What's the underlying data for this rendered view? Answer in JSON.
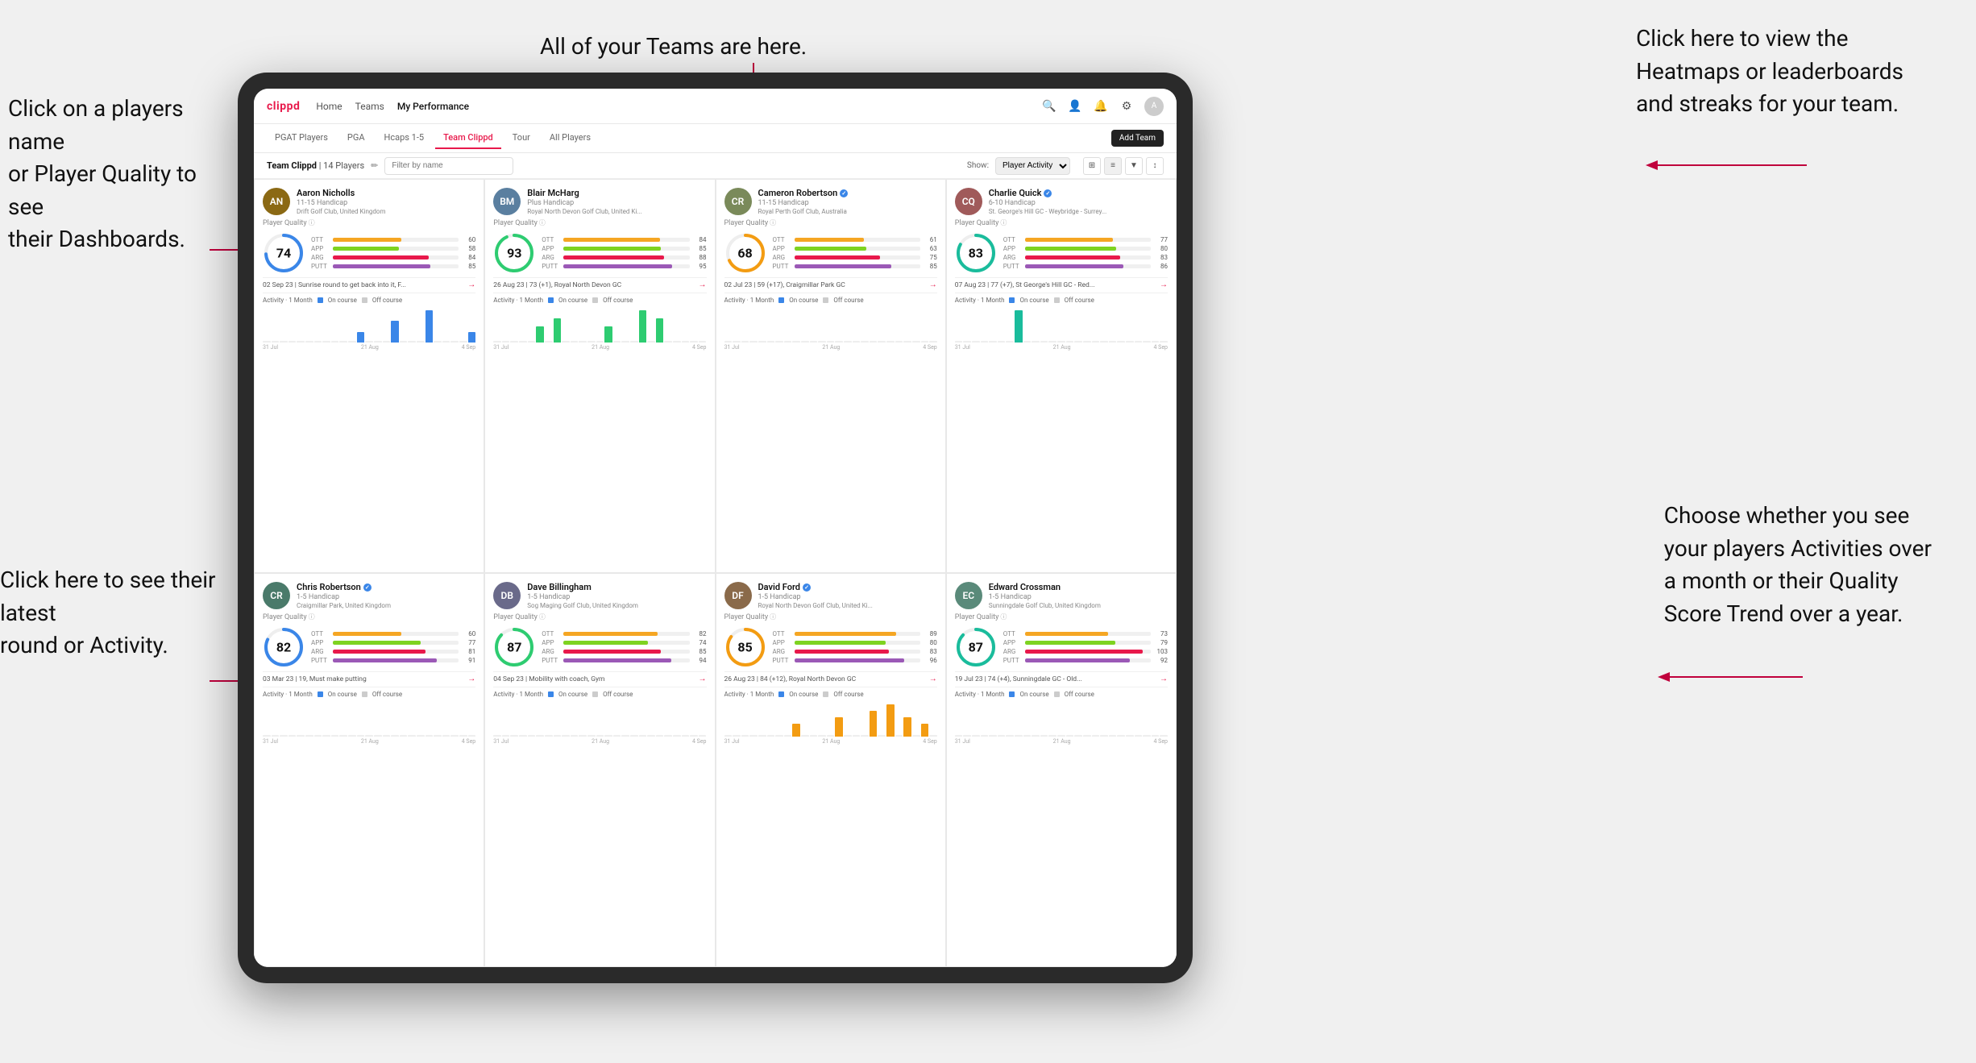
{
  "annotations": {
    "top_center": "All of your Teams are here.",
    "top_right": "Click here to view the\nHeatmaps or leaderboards\nand streaks for your team.",
    "left_top": "Click on a players name\nor Player Quality to see\ntheir Dashboards.",
    "left_bottom": "Click here to see their latest\nround or Activity.",
    "right_bottom": "Choose whether you see\nyour players Activities over\na month or their Quality\nScore Trend over a year."
  },
  "nav": {
    "logo": "clippd",
    "links": [
      "Home",
      "Teams",
      "My Performance"
    ],
    "active": "My Performance"
  },
  "sub_tabs": {
    "tabs": [
      "PGAT Players",
      "PGA",
      "Hcaps 1-5",
      "Team Clippd",
      "Tour",
      "All Players"
    ],
    "active": "Team Clippd",
    "add_button": "Add Team"
  },
  "team_header": {
    "title": "Team Clippd",
    "count": "14 Players",
    "filter_placeholder": "Filter by name",
    "show_label": "Show:",
    "show_options": [
      "Player Activity"
    ],
    "selected": "Player Activity"
  },
  "players": [
    {
      "name": "Aaron Nicholls",
      "handicap": "11-15 Handicap",
      "club": "Drift Golf Club, United Kingdom",
      "verified": false,
      "quality": 74,
      "circle_color": "#3a86e8",
      "stats": {
        "OTT": 60,
        "APP": 58,
        "ARG": 84,
        "PUTT": 85
      },
      "last_round": "02 Sep 23 | Sunrise round to get back into it, F...",
      "activity_bars": [
        0,
        0,
        0,
        0,
        0,
        0,
        0,
        0,
        0,
        0,
        0,
        1,
        0,
        0,
        0,
        2,
        0,
        0,
        0,
        3,
        0,
        0,
        0,
        0,
        1
      ],
      "chart_labels": [
        "31 Jul",
        "21 Aug",
        "4 Sep"
      ]
    },
    {
      "name": "Blair McHarg",
      "handicap": "Plus Handicap",
      "club": "Royal North Devon Golf Club, United Ki...",
      "verified": false,
      "quality": 93,
      "circle_color": "#2ecc71",
      "stats": {
        "OTT": 84,
        "APP": 85,
        "ARG": 88,
        "PUTT": 95
      },
      "last_round": "26 Aug 23 | 73 (+1), Royal North Devon GC",
      "activity_bars": [
        0,
        0,
        0,
        0,
        0,
        2,
        0,
        3,
        0,
        0,
        0,
        0,
        0,
        2,
        0,
        0,
        0,
        4,
        0,
        3,
        0,
        0,
        0,
        0,
        0
      ],
      "chart_labels": [
        "31 Jul",
        "21 Aug",
        "4 Sep"
      ]
    },
    {
      "name": "Cameron Robertson",
      "handicap": "11-15 Handicap",
      "club": "Royal Perth Golf Club, Australia",
      "verified": true,
      "quality": 68,
      "circle_color": "#f39c12",
      "stats": {
        "OTT": 61,
        "APP": 63,
        "ARG": 75,
        "PUTT": 85
      },
      "last_round": "02 Jul 23 | 59 (+17), Craigmillar Park GC",
      "activity_bars": [
        0,
        0,
        0,
        0,
        0,
        0,
        0,
        0,
        0,
        0,
        0,
        0,
        0,
        0,
        0,
        0,
        0,
        0,
        0,
        0,
        0,
        0,
        0,
        0,
        0
      ],
      "chart_labels": [
        "31 Jul",
        "21 Aug",
        "4 Sep"
      ]
    },
    {
      "name": "Charlie Quick",
      "handicap": "6-10 Handicap",
      "club": "St. George's Hill GC - Weybridge - Surrey...",
      "verified": true,
      "quality": 83,
      "circle_color": "#1abc9c",
      "stats": {
        "OTT": 77,
        "APP": 80,
        "ARG": 83,
        "PUTT": 86
      },
      "last_round": "07 Aug 23 | 77 (+7), St George's Hill GC - Red...",
      "activity_bars": [
        0,
        0,
        0,
        0,
        0,
        0,
        0,
        2,
        0,
        0,
        0,
        0,
        0,
        0,
        0,
        0,
        0,
        0,
        0,
        0,
        0,
        0,
        0,
        0,
        0
      ],
      "chart_labels": [
        "31 Jul",
        "21 Aug",
        "4 Sep"
      ]
    },
    {
      "name": "Chris Robertson",
      "handicap": "1-5 Handicap",
      "club": "Craigmillar Park, United Kingdom",
      "verified": true,
      "quality": 82,
      "circle_color": "#3a86e8",
      "stats": {
        "OTT": 60,
        "APP": 77,
        "ARG": 81,
        "PUTT": 91
      },
      "last_round": "03 Mar 23 | 19, Must make putting",
      "activity_bars": [
        0,
        0,
        0,
        0,
        0,
        0,
        0,
        0,
        0,
        0,
        0,
        0,
        0,
        0,
        0,
        0,
        0,
        0,
        0,
        0,
        0,
        0,
        0,
        0,
        0
      ],
      "chart_labels": [
        "31 Jul",
        "21 Aug",
        "4 Sep"
      ]
    },
    {
      "name": "Dave Billingham",
      "handicap": "1-5 Handicap",
      "club": "Sog Maging Golf Club, United Kingdom",
      "verified": false,
      "quality": 87,
      "circle_color": "#2ecc71",
      "stats": {
        "OTT": 82,
        "APP": 74,
        "ARG": 85,
        "PUTT": 94
      },
      "last_round": "04 Sep 23 | Mobility with coach, Gym",
      "activity_bars": [
        0,
        0,
        0,
        0,
        0,
        0,
        0,
        0,
        0,
        0,
        0,
        0,
        0,
        0,
        0,
        0,
        0,
        0,
        0,
        0,
        0,
        0,
        0,
        0,
        0
      ],
      "chart_labels": [
        "31 Jul",
        "21 Aug",
        "4 Sep"
      ]
    },
    {
      "name": "David Ford",
      "handicap": "1-5 Handicap",
      "club": "Royal North Devon Golf Club, United Ki...",
      "verified": true,
      "quality": 85,
      "circle_color": "#f39c12",
      "stats": {
        "OTT": 89,
        "APP": 80,
        "ARG": 83,
        "PUTT": 96
      },
      "last_round": "26 Aug 23 | 84 (+12), Royal North Devon GC",
      "activity_bars": [
        0,
        0,
        0,
        0,
        0,
        0,
        0,
        0,
        2,
        0,
        0,
        0,
        0,
        3,
        0,
        0,
        0,
        4,
        0,
        5,
        0,
        3,
        0,
        2,
        0
      ],
      "chart_labels": [
        "31 Jul",
        "21 Aug",
        "4 Sep"
      ]
    },
    {
      "name": "Edward Crossman",
      "handicap": "1-5 Handicap",
      "club": "Sunningdale Golf Club, United Kingdom",
      "verified": false,
      "quality": 87,
      "circle_color": "#1abc9c",
      "stats": {
        "OTT": 73,
        "APP": 79,
        "ARG": 103,
        "PUTT": 92
      },
      "last_round": "19 Jul 23 | 74 (+4), Sunningdale GC - Old...",
      "activity_bars": [
        0,
        0,
        0,
        0,
        0,
        0,
        0,
        0,
        0,
        0,
        0,
        0,
        0,
        0,
        0,
        0,
        0,
        0,
        0,
        0,
        0,
        0,
        0,
        0,
        0
      ],
      "chart_labels": [
        "31 Jul",
        "21 Aug",
        "4 Sep"
      ]
    }
  ],
  "activity_legend": {
    "period": "1 Month",
    "on_course_label": "On course",
    "off_course_label": "Off course",
    "on_course_color": "#3a86e8",
    "off_course_color": "#ccc"
  }
}
